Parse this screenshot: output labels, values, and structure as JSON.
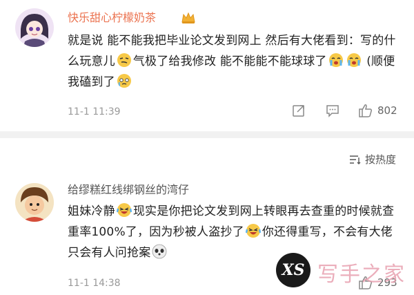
{
  "comments": [
    {
      "username": "快乐甜心柠檬奶茶",
      "text_parts": [
        "就是说 能不能我把毕业论文发到网上 然后有大佬看到：写的什么玩意儿",
        "气极了给我修改 能不能能不能球球了",
        " (顺便我磕到了",
        ""
      ],
      "time": "11-1 11:39",
      "likes": "802",
      "badge_icon": "crown-badge-icon"
    },
    {
      "username": "给缪糕红线绑钢丝的湾仔",
      "text_parts": [
        "姐妹冷静",
        "现实是你把论文发到网上转眼再去查重的时候就查重率100%了，因为秒被人盗抄了",
        "你还得重写，不会有大佬只会有人问抢案",
        ""
      ],
      "time": "11-1 14:38",
      "likes": "293"
    }
  ],
  "sort": {
    "label": "按热度"
  },
  "watermark": {
    "logo": "XS",
    "text": "写手之家"
  },
  "colors": {
    "username_highlight": "#eb7350",
    "divider": "#f1f1f1",
    "emoji_yellow": "#f7c948"
  }
}
